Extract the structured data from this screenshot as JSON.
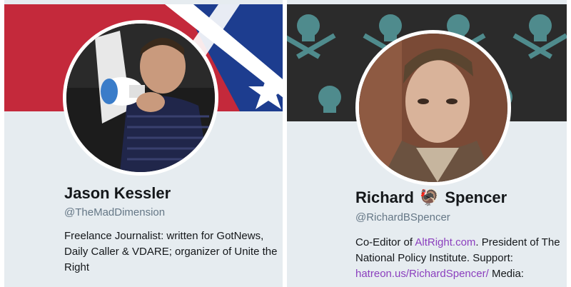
{
  "profiles": [
    {
      "name": "Jason Kessler",
      "handle": "@TheMadDimension",
      "bio": "Freelance Journalist: written for GotNews, Daily Caller & VDARE; organizer of Unite the Right",
      "banner_icon": "confederate-flag-banner",
      "avatar_icon": "man-with-megaphone-photo"
    },
    {
      "name_first": "Richard",
      "name_emoji": "🦃",
      "name_last": "Spencer",
      "handle": "@RichardBSpencer",
      "bio_parts": [
        {
          "text": "Co-Editor of ",
          "link": false
        },
        {
          "text": "AltRight.com",
          "link": true
        },
        {
          "text": ". President of The National Policy Institute. Support: ",
          "link": false
        },
        {
          "text": "hatreon.us/RichardSpencer/",
          "link": true
        },
        {
          "text": " Media:",
          "link": false
        }
      ],
      "banner_icon": "skull-crossbones-banner",
      "avatar_icon": "man-portrait-photo"
    }
  ],
  "colors": {
    "card_bg": "#e6ecf0",
    "link": "#8b3fbe",
    "handle": "#657786",
    "text": "#14171a",
    "skull": "#4f8b8d"
  }
}
